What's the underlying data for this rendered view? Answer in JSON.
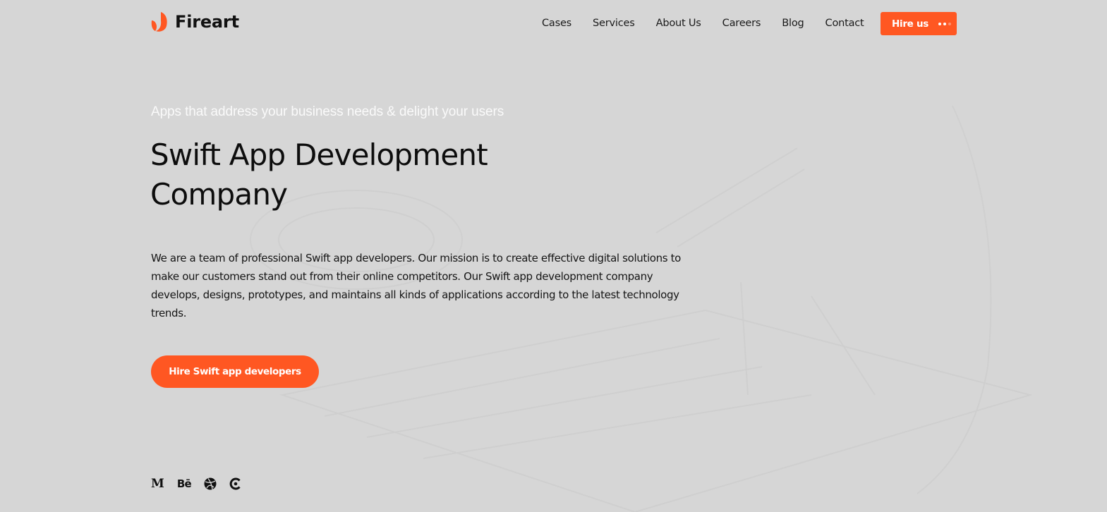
{
  "header": {
    "logo_text": "Fireart",
    "nav": [
      {
        "label": "Cases"
      },
      {
        "label": "Services"
      },
      {
        "label": "About Us"
      },
      {
        "label": "Careers"
      },
      {
        "label": "Blog"
      },
      {
        "label": "Contact"
      }
    ],
    "hire_button": "Hire us"
  },
  "hero": {
    "eyebrow": "Apps that address your business needs & delight your users",
    "title": "Swift App Development Company",
    "description": "We are a team of professional Swift app developers. Our mission is to create effective digital solutions to make our customers stand out from their online competitors. Our Swift app development company develops, designs, prototypes, and maintains all kinds of applications according to the latest technology trends.",
    "cta": "Hire Swift app developers"
  },
  "social": [
    {
      "name": "medium-icon",
      "glyph": "M"
    },
    {
      "name": "behance-icon",
      "glyph": "Bē"
    },
    {
      "name": "dribbble-icon",
      "glyph": ""
    },
    {
      "name": "clutch-icon",
      "glyph": ""
    }
  ],
  "colors": {
    "accent": "#ff5722",
    "background": "#d6d6d6",
    "text": "#111111",
    "eyebrow": "#fafafa"
  }
}
